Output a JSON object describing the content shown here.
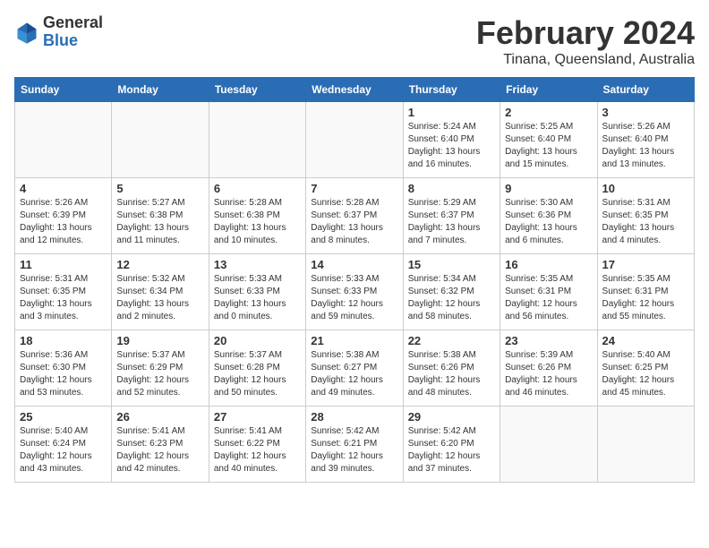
{
  "header": {
    "logo_general": "General",
    "logo_blue": "Blue",
    "title": "February 2024",
    "location": "Tinana, Queensland, Australia"
  },
  "weekdays": [
    "Sunday",
    "Monday",
    "Tuesday",
    "Wednesday",
    "Thursday",
    "Friday",
    "Saturday"
  ],
  "weeks": [
    [
      {
        "day": "",
        "info": ""
      },
      {
        "day": "",
        "info": ""
      },
      {
        "day": "",
        "info": ""
      },
      {
        "day": "",
        "info": ""
      },
      {
        "day": "1",
        "info": "Sunrise: 5:24 AM\nSunset: 6:40 PM\nDaylight: 13 hours\nand 16 minutes."
      },
      {
        "day": "2",
        "info": "Sunrise: 5:25 AM\nSunset: 6:40 PM\nDaylight: 13 hours\nand 15 minutes."
      },
      {
        "day": "3",
        "info": "Sunrise: 5:26 AM\nSunset: 6:40 PM\nDaylight: 13 hours\nand 13 minutes."
      }
    ],
    [
      {
        "day": "4",
        "info": "Sunrise: 5:26 AM\nSunset: 6:39 PM\nDaylight: 13 hours\nand 12 minutes."
      },
      {
        "day": "5",
        "info": "Sunrise: 5:27 AM\nSunset: 6:38 PM\nDaylight: 13 hours\nand 11 minutes."
      },
      {
        "day": "6",
        "info": "Sunrise: 5:28 AM\nSunset: 6:38 PM\nDaylight: 13 hours\nand 10 minutes."
      },
      {
        "day": "7",
        "info": "Sunrise: 5:28 AM\nSunset: 6:37 PM\nDaylight: 13 hours\nand 8 minutes."
      },
      {
        "day": "8",
        "info": "Sunrise: 5:29 AM\nSunset: 6:37 PM\nDaylight: 13 hours\nand 7 minutes."
      },
      {
        "day": "9",
        "info": "Sunrise: 5:30 AM\nSunset: 6:36 PM\nDaylight: 13 hours\nand 6 minutes."
      },
      {
        "day": "10",
        "info": "Sunrise: 5:31 AM\nSunset: 6:35 PM\nDaylight: 13 hours\nand 4 minutes."
      }
    ],
    [
      {
        "day": "11",
        "info": "Sunrise: 5:31 AM\nSunset: 6:35 PM\nDaylight: 13 hours\nand 3 minutes."
      },
      {
        "day": "12",
        "info": "Sunrise: 5:32 AM\nSunset: 6:34 PM\nDaylight: 13 hours\nand 2 minutes."
      },
      {
        "day": "13",
        "info": "Sunrise: 5:33 AM\nSunset: 6:33 PM\nDaylight: 13 hours\nand 0 minutes."
      },
      {
        "day": "14",
        "info": "Sunrise: 5:33 AM\nSunset: 6:33 PM\nDaylight: 12 hours\nand 59 minutes."
      },
      {
        "day": "15",
        "info": "Sunrise: 5:34 AM\nSunset: 6:32 PM\nDaylight: 12 hours\nand 58 minutes."
      },
      {
        "day": "16",
        "info": "Sunrise: 5:35 AM\nSunset: 6:31 PM\nDaylight: 12 hours\nand 56 minutes."
      },
      {
        "day": "17",
        "info": "Sunrise: 5:35 AM\nSunset: 6:31 PM\nDaylight: 12 hours\nand 55 minutes."
      }
    ],
    [
      {
        "day": "18",
        "info": "Sunrise: 5:36 AM\nSunset: 6:30 PM\nDaylight: 12 hours\nand 53 minutes."
      },
      {
        "day": "19",
        "info": "Sunrise: 5:37 AM\nSunset: 6:29 PM\nDaylight: 12 hours\nand 52 minutes."
      },
      {
        "day": "20",
        "info": "Sunrise: 5:37 AM\nSunset: 6:28 PM\nDaylight: 12 hours\nand 50 minutes."
      },
      {
        "day": "21",
        "info": "Sunrise: 5:38 AM\nSunset: 6:27 PM\nDaylight: 12 hours\nand 49 minutes."
      },
      {
        "day": "22",
        "info": "Sunrise: 5:38 AM\nSunset: 6:26 PM\nDaylight: 12 hours\nand 48 minutes."
      },
      {
        "day": "23",
        "info": "Sunrise: 5:39 AM\nSunset: 6:26 PM\nDaylight: 12 hours\nand 46 minutes."
      },
      {
        "day": "24",
        "info": "Sunrise: 5:40 AM\nSunset: 6:25 PM\nDaylight: 12 hours\nand 45 minutes."
      }
    ],
    [
      {
        "day": "25",
        "info": "Sunrise: 5:40 AM\nSunset: 6:24 PM\nDaylight: 12 hours\nand 43 minutes."
      },
      {
        "day": "26",
        "info": "Sunrise: 5:41 AM\nSunset: 6:23 PM\nDaylight: 12 hours\nand 42 minutes."
      },
      {
        "day": "27",
        "info": "Sunrise: 5:41 AM\nSunset: 6:22 PM\nDaylight: 12 hours\nand 40 minutes."
      },
      {
        "day": "28",
        "info": "Sunrise: 5:42 AM\nSunset: 6:21 PM\nDaylight: 12 hours\nand 39 minutes."
      },
      {
        "day": "29",
        "info": "Sunrise: 5:42 AM\nSunset: 6:20 PM\nDaylight: 12 hours\nand 37 minutes."
      },
      {
        "day": "",
        "info": ""
      },
      {
        "day": "",
        "info": ""
      }
    ]
  ]
}
